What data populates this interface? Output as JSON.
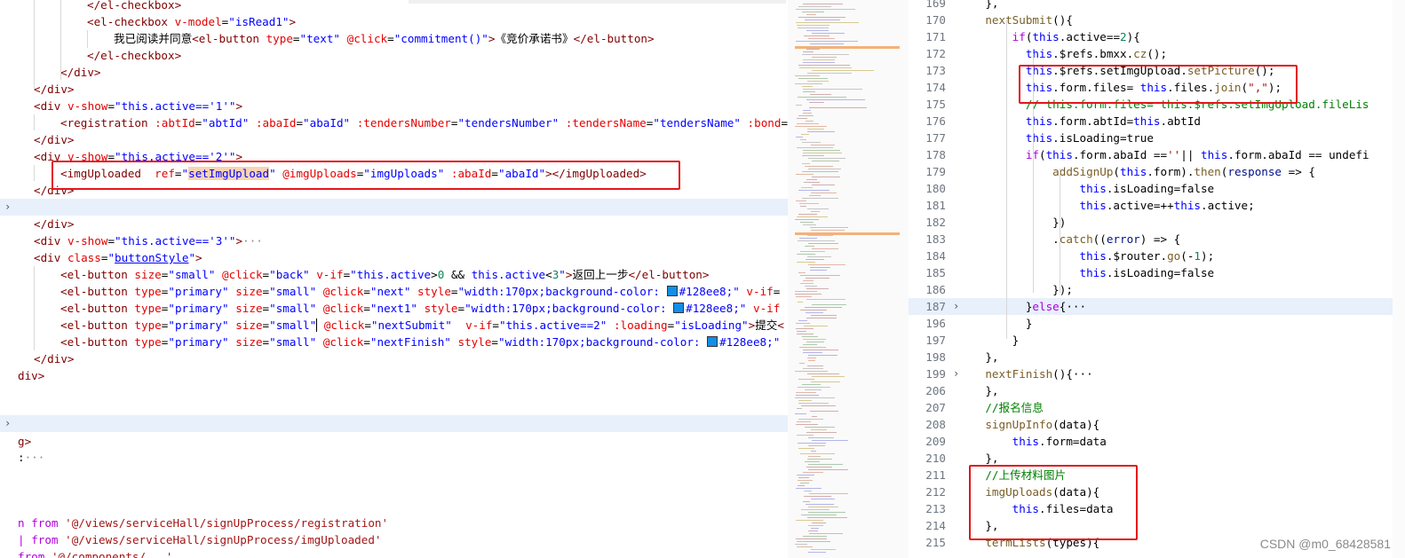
{
  "left_editor": {
    "lines": [
      {
        "t": "        </el-checkbox>",
        "ind": 4
      },
      {
        "t": "        <el-checkbox v-model=\"isRead1\">",
        "ind": 4
      },
      {
        "t": "            我已阅读并同意<el-button type=\"text\" @click=\"commitment()\">《竞价承诺书》</el-button>",
        "ind": 6
      },
      {
        "t": "        </el-checkbox>",
        "ind": 4
      },
      {
        "t": "    </div>",
        "ind": 2
      },
      {
        "t": "</div>",
        "ind": 1
      },
      {
        "t": "<div v-show=\"this.active=='1'\">",
        "ind": 1
      },
      {
        "t": "    <registration :abtId=\"abtId\" :abaId=\"abaId\" :tendersNumber=\"tendersNumber\" :tendersName=\"tendersName\" :bond=",
        "ind": 2
      },
      {
        "t": "</div>",
        "ind": 1
      },
      {
        "t": "<div v-show=\"this.active=='2'\">",
        "ind": 1
      },
      {
        "t": "    <imgUploaded  ref=\"setImgUpload\" @imgUploads=\"imgUploads\" :abaId=\"abaId\"></imgUploaded>",
        "ind": 2
      },
      {
        "t": "</div>",
        "ind": 1
      },
      {
        "t": "<div v-show=\"this.active=='3'\">···",
        "ind": 1
      },
      {
        "t": "</div>",
        "ind": 1
      },
      {
        "t": "",
        "ind": 0
      },
      {
        "t": "<div class=\"buttonStyle\">",
        "ind": 1
      },
      {
        "t": "    <el-button size=\"small\" @click=\"back\" v-if=\"this.active>0 && this.active<3\">返回上一步</el-button>",
        "ind": 2
      },
      {
        "t": "    <el-button type=\"primary\" size=\"small\" @click=\"next\" style=\"width:170px;background-color: #128ee8;\" v-if=",
        "ind": 2
      },
      {
        "t": "    <el-button type=\"primary\" size=\"small\" @click=\"next1\" style=\"width:170px;background-color: #128ee8;\" v-if",
        "ind": 2
      },
      {
        "t": "    <el-button type=\"primary\" size=\"small\" @click=\"nextSubmit\"  v-if=\"this.active==2\" :loading=\"isLoading\">提交<",
        "ind": 2
      },
      {
        "t": "    <el-button type=\"primary\" size=\"small\" @click=\"nextFinish\" style=\"width:170px;background-color: #128ee8;\"",
        "ind": 2
      },
      {
        "t": "</div>",
        "ind": 1
      },
      {
        "t": "div>",
        "ind": 0
      },
      {
        "t": "",
        "ind": 0
      },
      {
        "t": "",
        "ind": 0
      },
      {
        "t": ":···",
        "ind": 0
      },
      {
        "t": "g>",
        "ind": 0
      },
      {
        "t": "",
        "ind": 0
      },
      {
        "t": "",
        "ind": 0
      },
      {
        "t": "",
        "ind": 0
      },
      {
        "t": "n from '@/views/serviceHall/signUpProcess/registration'",
        "ind": 0
      },
      {
        "t": "| from '@/views/serviceHall/signUpProcess/imgUploaded'",
        "ind": 0
      },
      {
        "t": "from '@/components/...'",
        "ind": 0
      }
    ]
  },
  "right_editor": {
    "lines": [
      {
        "n": "169",
        "t": "    },"
      },
      {
        "n": "170",
        "t": "    nextSubmit(){"
      },
      {
        "n": "171",
        "t": "        if(this.active==2){"
      },
      {
        "n": "172",
        "t": "          this.$refs.bmxx.cz();"
      },
      {
        "n": "173",
        "t": "          this.$refs.setImgUpload.setPicture();"
      },
      {
        "n": "174",
        "t": "          this.form.files= this.files.join(\",\");"
      },
      {
        "n": "175",
        "t": "          // this.form.files= this.$refs.setImgUpload.fileLis"
      },
      {
        "n": "176",
        "t": "          this.form.abtId=this.abtId"
      },
      {
        "n": "177",
        "t": "          this.isLoading=true"
      },
      {
        "n": "178",
        "t": "          if(this.form.abaId ==''|| this.form.abaId == undefi"
      },
      {
        "n": "179",
        "t": "              addSignUp(this.form).then(response => {"
      },
      {
        "n": "180",
        "t": "                  this.isLoading=false"
      },
      {
        "n": "181",
        "t": "                  this.active=++this.active;"
      },
      {
        "n": "182",
        "t": "              })"
      },
      {
        "n": "183",
        "t": "              .catch((error) => {"
      },
      {
        "n": "184",
        "t": "                  this.$router.go(-1);"
      },
      {
        "n": "185",
        "t": "                  this.isLoading=false"
      },
      {
        "n": "186",
        "t": "              });"
      },
      {
        "n": "187",
        "t": "          }else{···"
      },
      {
        "n": "196",
        "t": "          }"
      },
      {
        "n": "197",
        "t": "        }"
      },
      {
        "n": "198",
        "t": "    },"
      },
      {
        "n": "199",
        "t": "    nextFinish(){···"
      },
      {
        "n": "206",
        "t": "    },"
      },
      {
        "n": "207",
        "t": "    //报名信息"
      },
      {
        "n": "208",
        "t": "    signUpInfo(data){"
      },
      {
        "n": "209",
        "t": "        this.form=data"
      },
      {
        "n": "210",
        "t": "    },"
      },
      {
        "n": "211",
        "t": "    //上传材料图片"
      },
      {
        "n": "212",
        "t": "    imgUploads(data){"
      },
      {
        "n": "213",
        "t": "        this.files=data"
      },
      {
        "n": "214",
        "t": "    },"
      },
      {
        "n": "215",
        "t": "    termLists(types){"
      }
    ]
  },
  "watermark": "CSDN @m0_68428581",
  "colors": {
    "highlight_box": "#e3151a",
    "swatch": "#128ee8",
    "current_line": "#e7f0fb"
  }
}
